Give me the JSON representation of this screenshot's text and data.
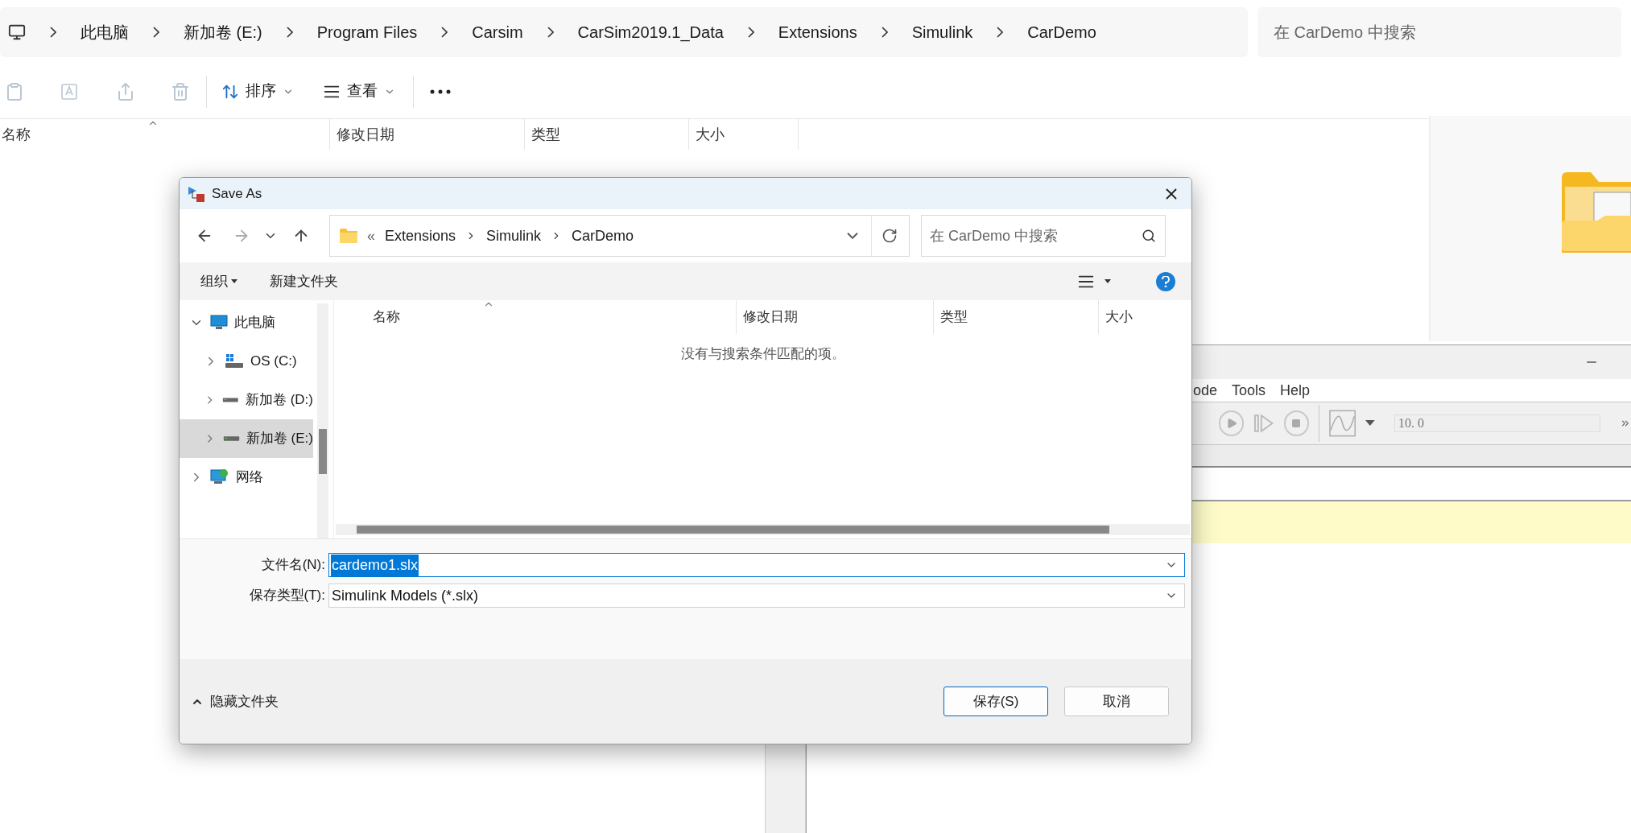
{
  "explorer": {
    "breadcrumb": [
      "此电脑",
      "新加卷 (E:)",
      "Program Files",
      "Carsim",
      "CarSim2019.1_Data",
      "Extensions",
      "Simulink",
      "CarDemo"
    ],
    "search": {
      "placeholder": "在 CarDemo 中搜索"
    },
    "toolbar": [
      {
        "label": "排序",
        "kind": "sort"
      },
      {
        "label": "查看",
        "kind": "view"
      }
    ],
    "columns": [
      "名称",
      "修改日期",
      "类型",
      "大小"
    ]
  },
  "simulink": {
    "menu": [
      "ode",
      "Tools",
      "Help"
    ],
    "stop_time": "10. 0"
  },
  "dialog": {
    "title": "Save As",
    "path_prefix": "«",
    "path": [
      "Extensions",
      "Simulink",
      "CarDemo"
    ],
    "search": {
      "placeholder": "在 CarDemo 中搜索"
    },
    "commands": [
      {
        "label": "组织",
        "dropdown": true
      },
      {
        "label": "新建文件夹",
        "dropdown": false
      }
    ],
    "tree": [
      {
        "label": "此电脑",
        "kind": "computer",
        "expanded": true,
        "selected": false,
        "children": [
          {
            "label": "OS (C:)",
            "kind": "os-drive",
            "expanded": false,
            "selected": false
          },
          {
            "label": "新加卷 (D:)",
            "kind": "drive",
            "expanded": false,
            "selected": false
          },
          {
            "label": "新加卷 (E:)",
            "kind": "drive",
            "expanded": false,
            "selected": true
          }
        ]
      },
      {
        "label": "网络",
        "kind": "network",
        "expanded": false,
        "selected": false
      }
    ],
    "columns": [
      "名称",
      "修改日期",
      "类型",
      "大小"
    ],
    "empty_message": "没有与搜索条件匹配的项。",
    "fields": [
      {
        "label": "文件名(N):",
        "value": "cardemo1.slx",
        "focused": true
      },
      {
        "label": "保存类型(T):",
        "value": "Simulink Models (*.slx)",
        "focused": false
      }
    ],
    "hide_folders": "隐藏文件夹",
    "buttons": [
      {
        "label": "保存(S)",
        "default": true
      },
      {
        "label": "取消",
        "default": false
      }
    ]
  }
}
